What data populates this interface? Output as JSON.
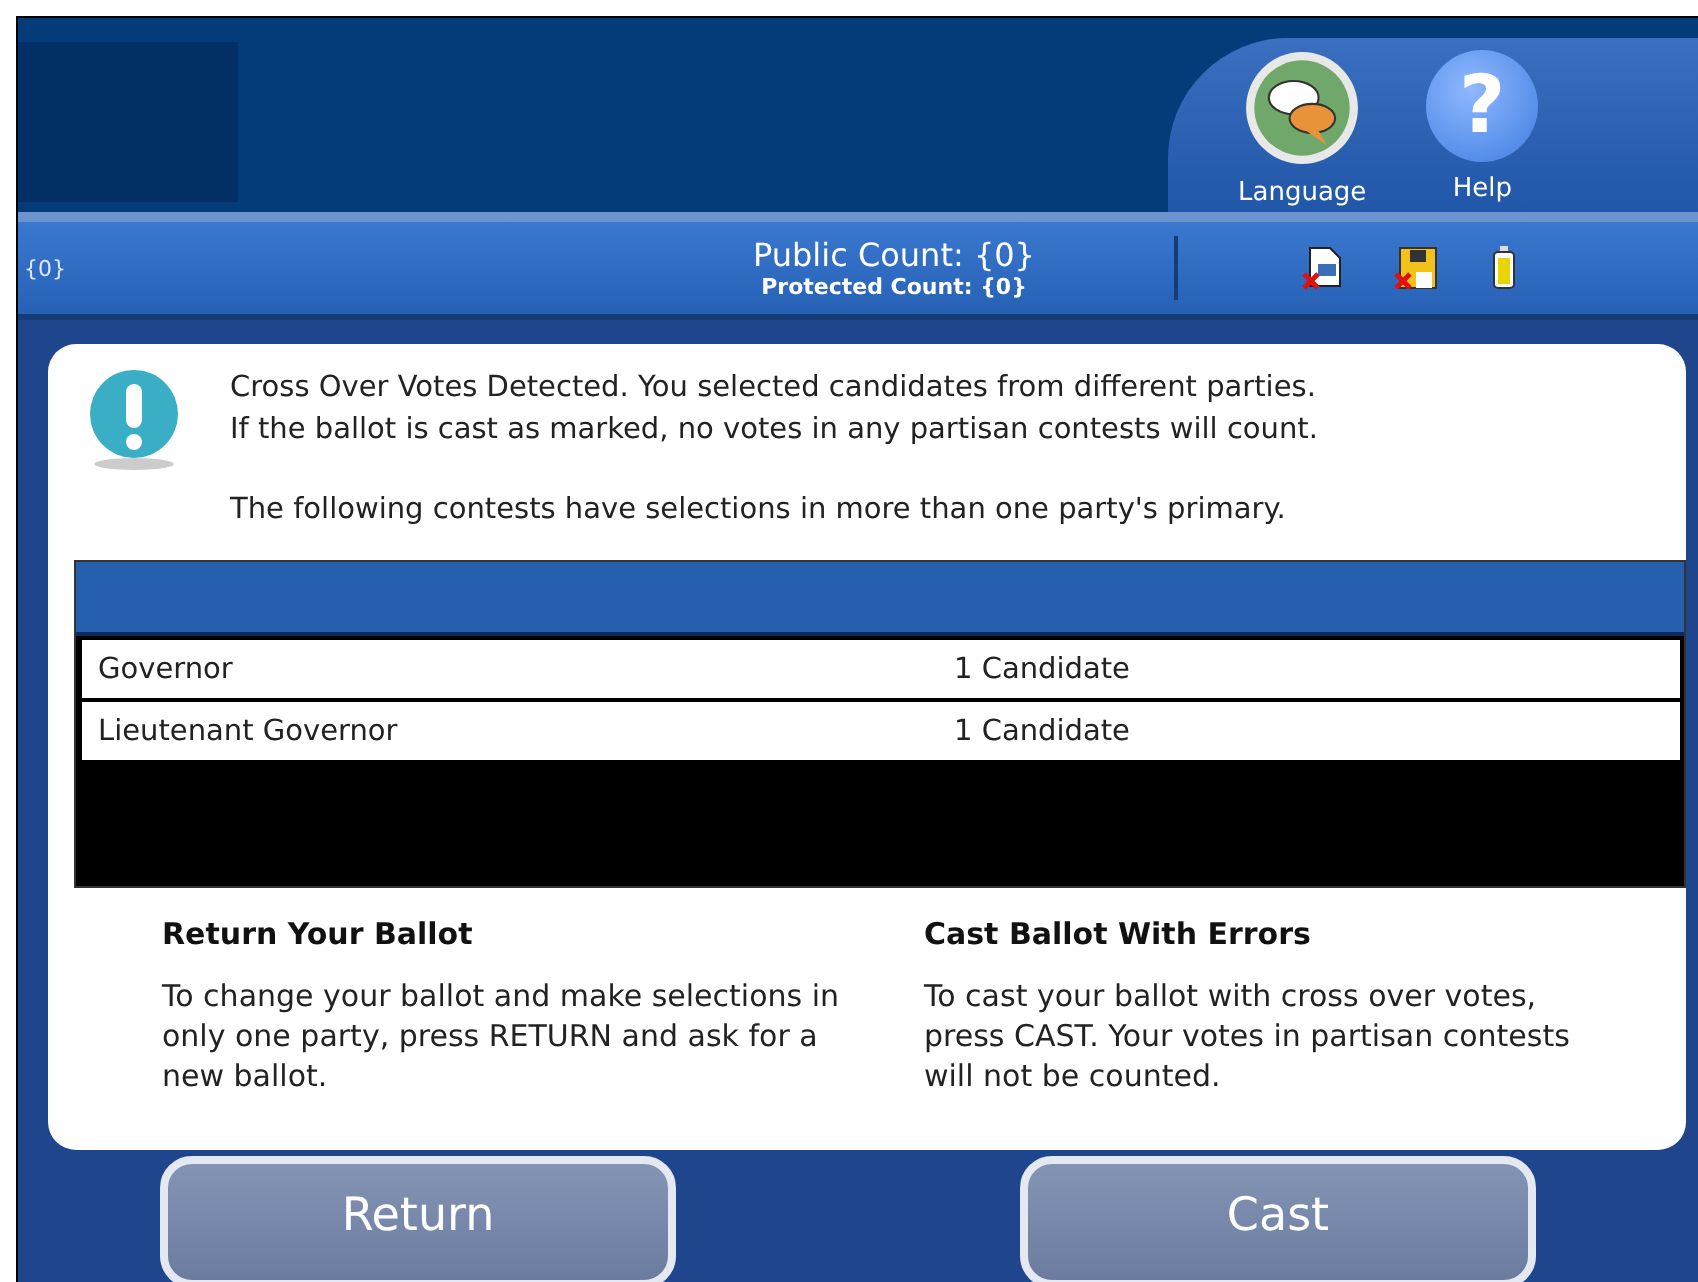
{
  "header": {
    "buttons": [
      {
        "kind": "language",
        "label": "Language"
      },
      {
        "kind": "help",
        "label": "Help",
        "glyph": "?"
      }
    ]
  },
  "status_bar": {
    "left": "{0}",
    "public_count": "Public Count: {0}",
    "protected_count": "Protected Count: {0}"
  },
  "message": {
    "lines": [
      "Cross Over Votes Detected. You selected candidates from different parties.",
      "If the ballot is cast as marked, no votes in any partisan contests will count."
    ],
    "note": "The following contests have selections in more than one party's primary."
  },
  "table": {
    "rows": [
      {
        "contest": "Governor",
        "selections": "1 Candidate"
      },
      {
        "contest": "Lieutenant Governor",
        "selections": "1 Candidate"
      }
    ]
  },
  "options": [
    {
      "title": "Return Your Ballot",
      "text": "To change your ballot and make selections in only one party, press RETURN and ask for a new ballot."
    },
    {
      "title": "Cast Ballot With Errors",
      "text": "To cast your ballot with cross over votes, press CAST. Your votes in partisan contests will not be counted."
    }
  ],
  "buttons": [
    "Return",
    "Cast"
  ]
}
